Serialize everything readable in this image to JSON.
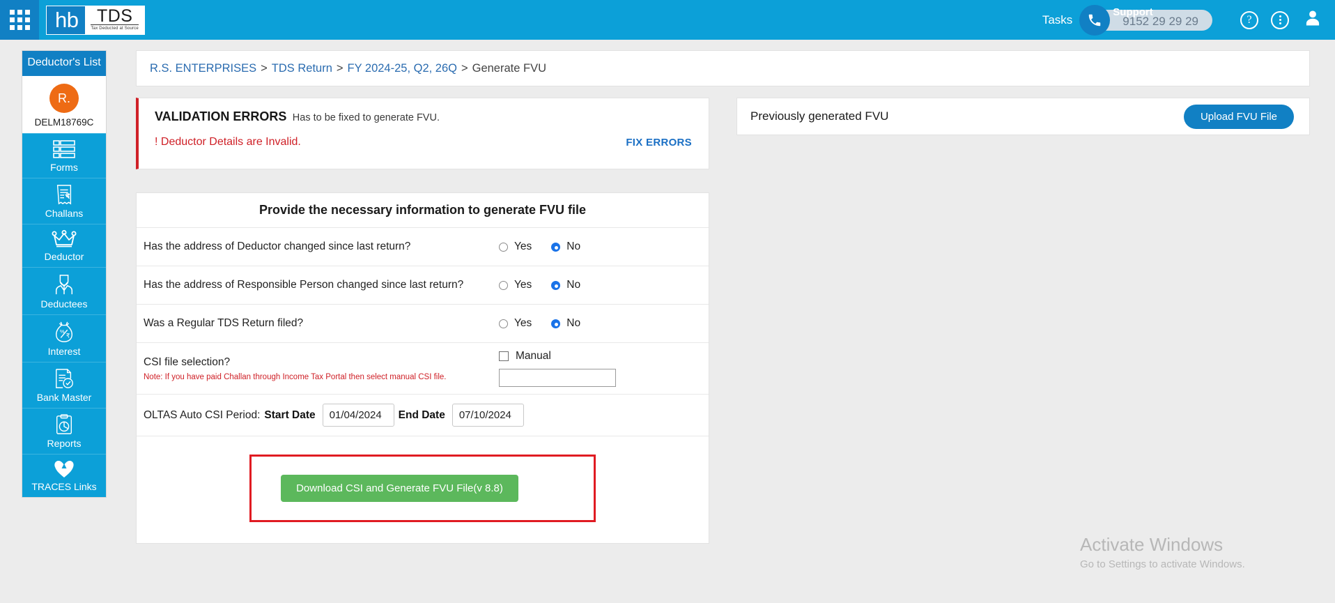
{
  "header": {
    "apps_icon": "grid-apps-icon",
    "logo_hb": "hb",
    "logo_tds": "TDS",
    "logo_tagline": "Tax Deducted at Source",
    "tasks_label": "Tasks",
    "support_label": "Support",
    "support_number": "9152 29 29 29",
    "help_icon": "?",
    "more_icon": "kebab-menu-icon",
    "user_icon": "user-avatar-icon",
    "bg_color": "#0CA0D8",
    "accent_color": "#1180C4"
  },
  "sidebar": {
    "title": "Deductor's List",
    "avatar_initial": "R.",
    "avatar_color": "#EE6B14",
    "pan": "DELM18769C",
    "items": [
      {
        "label": "Forms",
        "icon": "forms-icon"
      },
      {
        "label": "Challans",
        "icon": "challan-receipt-icon"
      },
      {
        "label": "Deductor",
        "icon": "crown-icon"
      },
      {
        "label": "Deductees",
        "icon": "person-icon"
      },
      {
        "label": "Interest",
        "icon": "money-bag-icon"
      },
      {
        "label": "Bank Master",
        "icon": "bank-document-check-icon"
      },
      {
        "label": "Reports",
        "icon": "clipboard-chart-icon"
      },
      {
        "label": "TRACES Links",
        "icon": "traces-logo-icon"
      }
    ]
  },
  "breadcrumb": {
    "items": [
      "R.S. ENTERPRISES",
      "TDS Return",
      "FY 2024-25, Q2, 26Q"
    ],
    "separator": ">",
    "current": "Generate FVU"
  },
  "alert": {
    "title": "VALIDATION ERRORS",
    "subtitle": "Has to be fixed to generate FVU.",
    "error": "! Deductor Details are Invalid.",
    "action": "FIX ERRORS",
    "color": "#cf2027"
  },
  "form": {
    "heading": "Provide the necessary information to generate FVU file",
    "rows": [
      {
        "label": "Has the address of Deductor changed since last return?",
        "yes": "Yes",
        "no": "No",
        "selected": "No"
      },
      {
        "label": "Has the address of Responsible Person changed since last return?",
        "yes": "Yes",
        "no": "No",
        "selected": "No"
      },
      {
        "label": "Was a Regular TDS Return filed?",
        "yes": "Yes",
        "no": "No",
        "selected": "No"
      }
    ],
    "csi": {
      "label": "CSI file selection?",
      "note": "Note: If you have paid Challan through Income Tax Portal then select manual CSI file.",
      "manual_label": "Manual",
      "manual_checked": false,
      "manual_value": "",
      "manual_placeholder": ""
    },
    "oltas": {
      "prefix": "OLTAS Auto CSI Period:",
      "start_label": "Start Date",
      "start_value": "01/04/2024",
      "end_label": "End Date",
      "end_value": "07/10/2024"
    },
    "submit_label": "Download CSI and Generate FVU File(v 8.8)",
    "submit_color": "#5cb85c",
    "highlight_color": "#e01b22"
  },
  "side_panel": {
    "title": "Previously generated FVU",
    "upload_label": "Upload FVU File",
    "upload_color": "#1180C4"
  },
  "watermark": {
    "line1": "Activate Windows",
    "line2": "Go to Settings to activate Windows."
  }
}
